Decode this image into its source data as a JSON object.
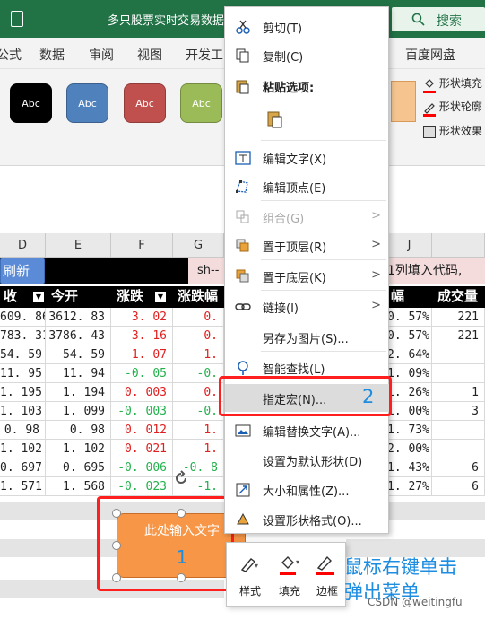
{
  "title_bar": {
    "title": "多只股票实时交易数据",
    "search_label": "搜索"
  },
  "tabs": [
    "公式",
    "数据",
    "审阅",
    "视图",
    "开发工",
    "百度网盘"
  ],
  "shape_styles": [
    {
      "label": "Abc",
      "color": "#000000"
    },
    {
      "label": "Abc",
      "color": "#4f81bd"
    },
    {
      "label": "Abc",
      "color": "#c0504d"
    },
    {
      "label": "Abc",
      "color": "#9bbb59"
    }
  ],
  "shape_format": {
    "fill": "形状填充",
    "outline": "形状轮廓",
    "effect": "形状效果"
  },
  "columns": [
    "D",
    "E",
    "F",
    "G",
    "J"
  ],
  "sheet": {
    "refresh_button": "刷新",
    "status_prefix": "sh--",
    "instruction": "1列填入代码,",
    "headers": {
      "d": "收",
      "e": "今开",
      "f": "涨跌",
      "g": "涨跌幅",
      "j": "幅",
      "k": "成交量"
    },
    "rows": [
      {
        "d": "609. 86",
        "e": "3612. 83",
        "f": "3. 02",
        "g": "0.",
        "j": "0. 57%",
        "k": "221",
        "f_color": "#e02020"
      },
      {
        "d": "783. 31",
        "e": "3786. 43",
        "f": "3. 16",
        "g": "0.",
        "j": "0. 57%",
        "k": "221",
        "f_color": "#e02020"
      },
      {
        "d": "54. 59",
        "e": "54. 59",
        "f": "1. 07",
        "g": "1.",
        "j": "2. 64%",
        "k": "",
        "f_color": "#e02020"
      },
      {
        "d": "11. 95",
        "e": "11. 94",
        "f": "-0. 05",
        "g": "-0.",
        "j": "1. 09%",
        "k": "",
        "f_color": "#22b14c"
      },
      {
        "d": "1. 195",
        "e": "1. 194",
        "f": "0. 003",
        "g": "0.",
        "j": "1. 26%",
        "k": "1",
        "f_color": "#e02020"
      },
      {
        "d": "1. 103",
        "e": "1. 099",
        "f": "-0. 003",
        "g": "-0.",
        "j": "1. 00%",
        "k": "3",
        "f_color": "#22b14c"
      },
      {
        "d": "0. 98",
        "e": "0. 98",
        "f": "0. 012",
        "g": "1.",
        "j": "1. 73%",
        "k": "",
        "f_color": "#e02020"
      },
      {
        "d": "1. 102",
        "e": "1. 102",
        "f": "0. 021",
        "g": "1.",
        "j": "2. 00%",
        "k": "",
        "f_color": "#e02020"
      },
      {
        "d": "0. 697",
        "e": "0. 695",
        "f": "-0. 006",
        "g": "-0. 8",
        "j": "1. 43%",
        "k": "6",
        "f_color": "#22b14c"
      },
      {
        "d": "1. 571",
        "e": "1. 568",
        "f": "-0. 023",
        "g": "-1.",
        "j": "1. 27%",
        "k": "6",
        "f_color": "#22b14c"
      }
    ]
  },
  "shape": {
    "text": "此处输入文字"
  },
  "context_menu": {
    "items": [
      {
        "label": "剪切(T)",
        "icon": "scissors-icon"
      },
      {
        "label": "复制(C)",
        "icon": "copy-icon"
      },
      {
        "label": "粘贴选项:",
        "icon": "paste-icon",
        "bold": true
      },
      {
        "label": "",
        "icon": "paste-option-icon"
      },
      {
        "label": "编辑文字(X)",
        "icon": "edit-text-icon"
      },
      {
        "label": "编辑顶点(E)",
        "icon": "edit-points-icon"
      },
      {
        "label": "组合(G)",
        "icon": "group-icon",
        "disabled": true,
        "submenu": true
      },
      {
        "label": "置于顶层(R)",
        "icon": "bring-front-icon",
        "submenu": true
      },
      {
        "label": "置于底层(K)",
        "icon": "send-back-icon",
        "submenu": true
      },
      {
        "label": "链接(I)",
        "icon": "link-icon",
        "submenu": true
      },
      {
        "label": "另存为图片(S)...",
        "icon": ""
      },
      {
        "label": "智能查找(L)",
        "icon": "smart-lookup-icon"
      },
      {
        "label": "指定宏(N)...",
        "icon": "",
        "highlighted": true
      },
      {
        "label": "编辑替换文字(A)...",
        "icon": "alt-text-icon"
      },
      {
        "label": "设置为默认形状(D)",
        "icon": ""
      },
      {
        "label": "大小和属性(Z)...",
        "icon": "size-properties-icon"
      },
      {
        "label": "设置形状格式(O)...",
        "icon": "format-shape-icon"
      }
    ]
  },
  "mini_toolbar": {
    "style": "样式",
    "fill": "填充",
    "outline": "边框"
  },
  "annotations": {
    "num1": "1",
    "num2": "2",
    "note_line1": "鼠标右键单击",
    "note_line2": "弹出菜单",
    "watermark": "CSDN @weitingfu"
  }
}
